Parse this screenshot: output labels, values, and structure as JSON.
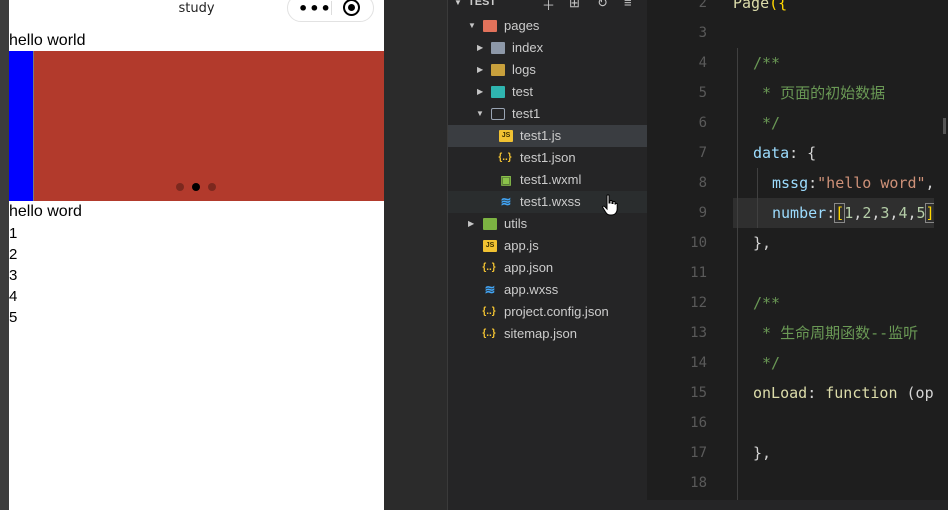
{
  "simulator": {
    "nav_title": "study",
    "capsule_more": "•••",
    "text_top": "hello world",
    "text_msg": "hello word",
    "numbers": [
      "1",
      "2",
      "3",
      "4",
      "5"
    ],
    "swiper": {
      "slide_color": "#b23a2c",
      "prev_slide_color": "#0000ff",
      "dots": 3,
      "active_dot": 1
    }
  },
  "explorer": {
    "title": "TEST",
    "actions": [
      "new-file",
      "new-folder",
      "refresh",
      "collapse"
    ],
    "items": [
      {
        "label": "pages",
        "icon": "folder-red-icon",
        "expanded": true
      },
      {
        "label": "index",
        "icon": "folder-icon"
      },
      {
        "label": "logs",
        "icon": "folder-yellow-icon"
      },
      {
        "label": "test",
        "icon": "folder-cyan-icon"
      },
      {
        "label": "test1",
        "icon": "folder-open-icon",
        "expanded": true
      },
      {
        "label": "test1.js",
        "icon": "js-file-icon",
        "selected": true
      },
      {
        "label": "test1.json",
        "icon": "json-file-icon"
      },
      {
        "label": "test1.wxml",
        "icon": "wxml-file-icon"
      },
      {
        "label": "test1.wxss",
        "icon": "wxss-file-icon",
        "hovered": true
      },
      {
        "label": "utils",
        "icon": "folder-green-icon"
      },
      {
        "label": "app.js",
        "icon": "js-file-icon"
      },
      {
        "label": "app.json",
        "icon": "json-file-icon"
      },
      {
        "label": "app.wxss",
        "icon": "wxss-file-icon"
      },
      {
        "label": "project.config.json",
        "icon": "json-file-icon"
      },
      {
        "label": "sitemap.json",
        "icon": "json-file-icon"
      }
    ]
  },
  "editor": {
    "line_numbers": [
      "2",
      "3",
      "4",
      "5",
      "6",
      "7",
      "8",
      "9",
      "10",
      "11",
      "12",
      "13",
      "14",
      "15",
      "16",
      "17",
      "18"
    ],
    "lines": {
      "l2_fn": "Page",
      "l2_br": "({",
      "l4": "/**",
      "l5": " * 页面的初始数据",
      "l6": " */",
      "l7_key": "data",
      "l7_rest": ": {",
      "l8_key": "mssg",
      "l8_colon": ":",
      "l8_str": "\"hello word\"",
      "l8_tail": ",",
      "l9_key": "number",
      "l9_colon": ":",
      "l9_open": "[",
      "l9_vals": [
        "1",
        "2",
        "3",
        "4",
        "5"
      ],
      "l9_close": "]",
      "l10": "},",
      "l12": "/**",
      "l13": " * 生命周期函数--监听",
      "l14": " */",
      "l15_key": "onLoad",
      "l15_colon": ": ",
      "l15_kw": "function",
      "l15_rest": " (op",
      "l17": "},"
    }
  }
}
